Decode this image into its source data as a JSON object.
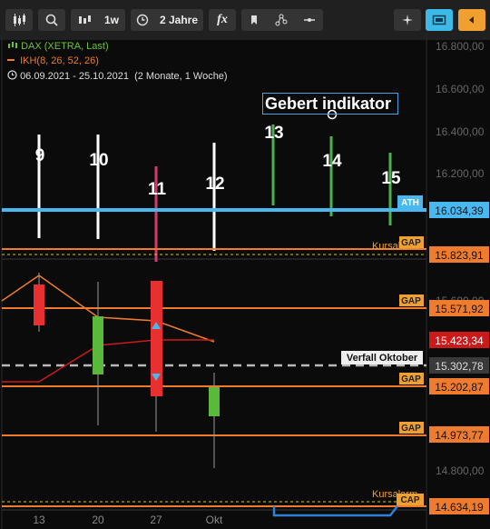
{
  "toolbar": {
    "interval": "1w",
    "period": "2 Jahre",
    "fx": "fx",
    "colors": {
      "active_blue": "#3dbbe8",
      "active_orange": "#f0a030"
    }
  },
  "legend": {
    "instrument": "DAX (XETRA, Last)",
    "indicator": "IKH(8, 26, 52, 26)",
    "range": "06.09.2021 - 25.10.2021",
    "range_note": "(2 Monate, 1 Woche)"
  },
  "annotation": "Gebert  indikator",
  "chart_data": {
    "type": "candlestick",
    "y_ticks": [
      "16.800,00",
      "16.600,00",
      "16.400,00",
      "16.200,00",
      "15.600,00",
      "14.800,00"
    ],
    "x_ticks": [
      "13",
      "20",
      "27",
      "Okt"
    ],
    "bar_labels": [
      {
        "text": "9",
        "color": "#ffffff"
      },
      {
        "text": "10",
        "color": "#ffffff"
      },
      {
        "text": "11",
        "color": "#d63a6a"
      },
      {
        "text": "12",
        "color": "#ffffff"
      },
      {
        "text": "13",
        "color": "#4caf50"
      },
      {
        "text": "14",
        "color": "#4caf50"
      },
      {
        "text": "15",
        "color": "#4caf50"
      }
    ],
    "level_lines": [
      {
        "label": "ATH",
        "price": "16.034,39",
        "color": "#4ab8f0"
      },
      {
        "label": "GAP",
        "price": "15.823,91",
        "color": "#ef7c2e",
        "extra": "Kursalarm"
      },
      {
        "label": "GAP",
        "price": "15.571,92",
        "color": "#ef7c2e"
      },
      {
        "label": "",
        "price": "15.423,34",
        "color": "#cc1a1a"
      },
      {
        "label": "Verfall Oktober",
        "price": "15.302,78",
        "color": "#b8b8b8"
      },
      {
        "label": "GAP",
        "price": "15.202,87",
        "color": "#ef7c2e"
      },
      {
        "label": "GAP",
        "price": "14.973,77",
        "color": "#ef7c2e"
      },
      {
        "label": "CAP",
        "price": "14.634,19",
        "color": "#ef7c2e",
        "extra": "Kursalarm"
      }
    ]
  }
}
